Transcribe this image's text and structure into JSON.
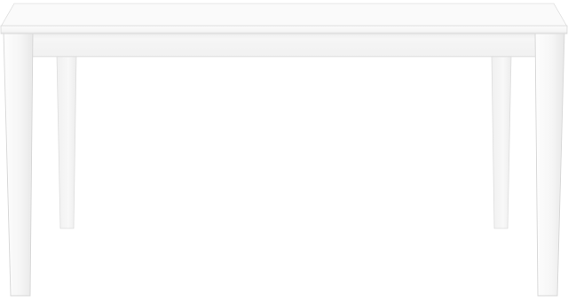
{
  "product": {
    "object": "dining-table",
    "view": "front",
    "colors": {
      "background": "#ffffff",
      "finish": "#f7f7f7",
      "tabletop_shadow": "#e4e4e4",
      "apron": "#f4f4f4",
      "apron_shadow": "#e9e9e9",
      "leg_highlight": "#fbfbfb",
      "leg_shadow": "#e6e6e6",
      "outline": "#d9d9d9"
    }
  }
}
